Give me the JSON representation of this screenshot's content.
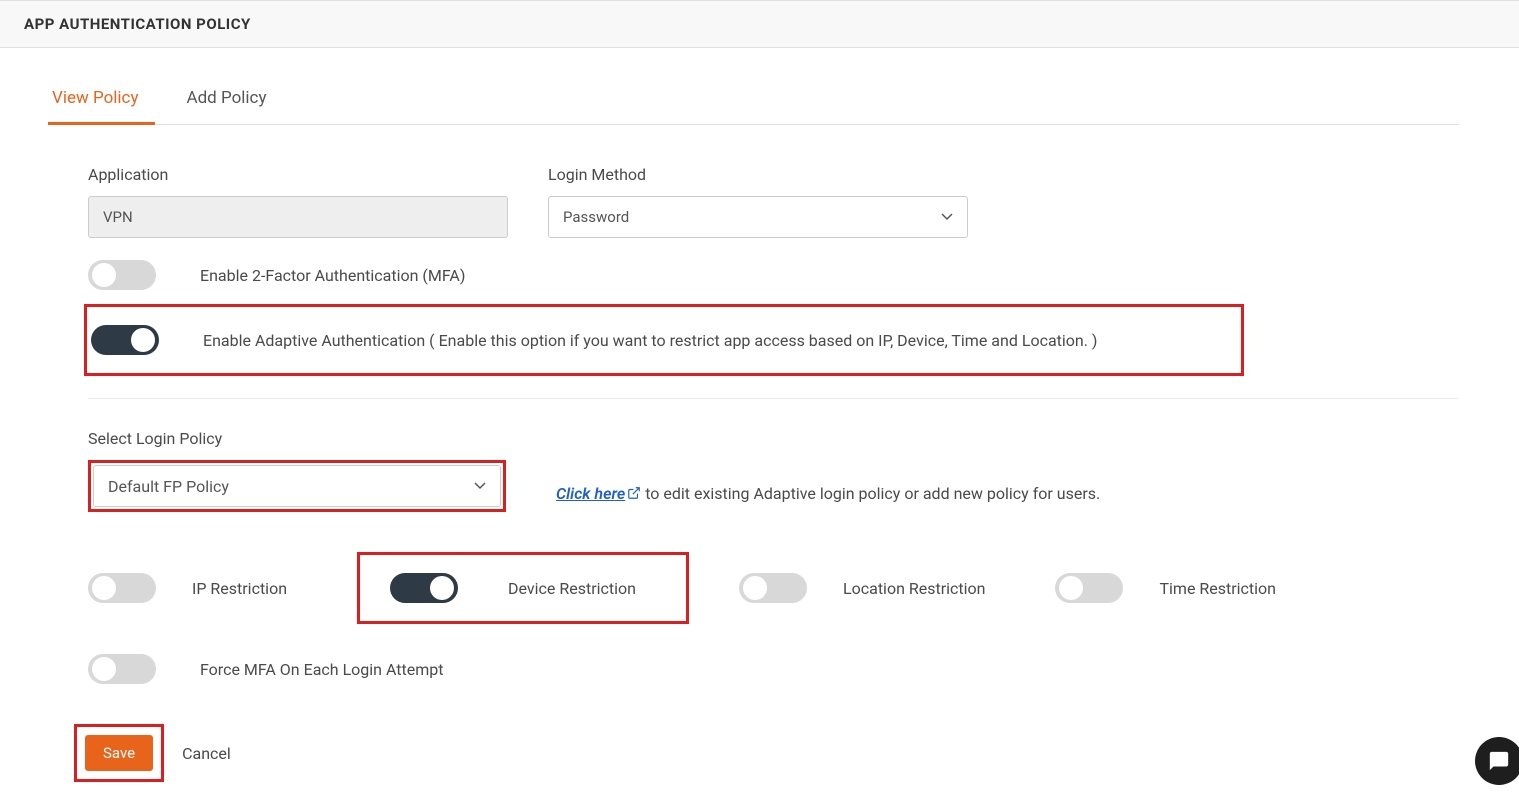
{
  "header": {
    "title": "APP AUTHENTICATION POLICY"
  },
  "tabs": {
    "view": "View Policy",
    "add": "Add Policy"
  },
  "fields": {
    "application_label": "Application",
    "application_value": "VPN",
    "login_method_label": "Login Method",
    "login_method_value": "Password",
    "mfa_label": "Enable 2-Factor Authentication (MFA)",
    "adaptive_label": "Enable Adaptive Authentication ( Enable this option if you want to restrict app access based on IP, Device, Time and Location. )",
    "select_login_label": "Select Login Policy",
    "select_login_value": "Default FP Policy",
    "click_here": "Click here",
    "click_here_rest": " to edit existing Adaptive login policy or add new policy for users.",
    "ip_restriction": "IP Restriction",
    "device_restriction": "Device Restriction",
    "location_restriction": "Location Restriction",
    "time_restriction": "Time Restriction",
    "force_mfa": "Force MFA On Each Login Attempt"
  },
  "actions": {
    "save": "Save",
    "cancel": "Cancel"
  }
}
